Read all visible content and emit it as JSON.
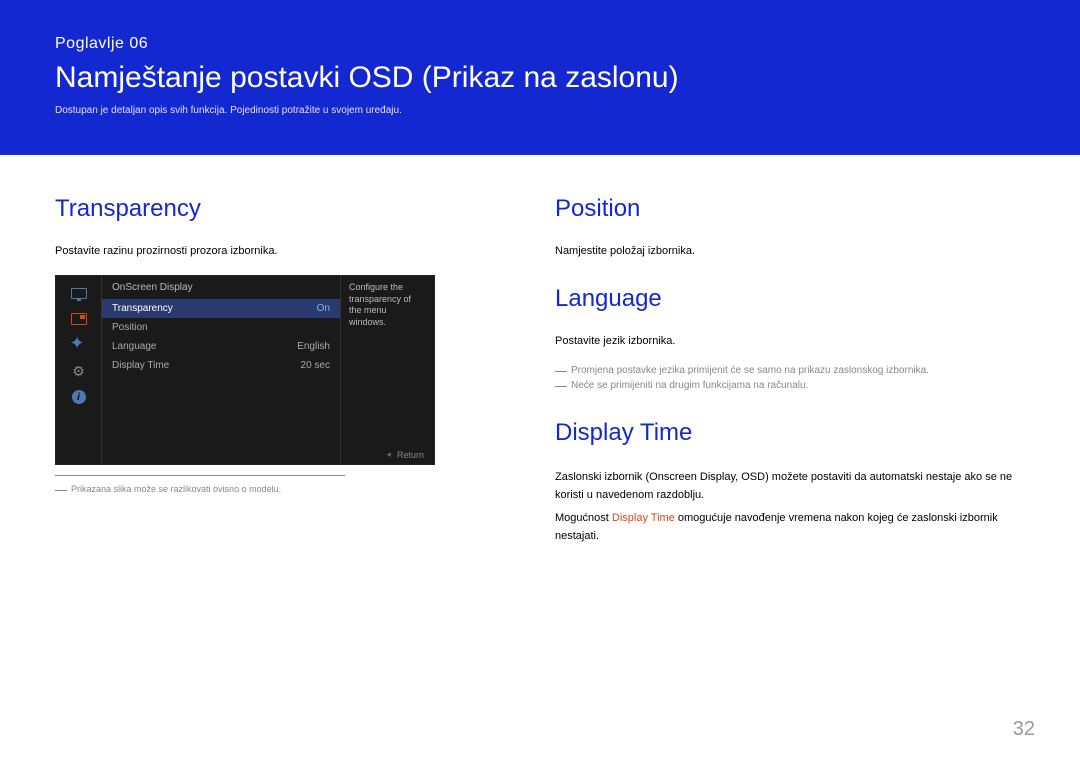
{
  "header": {
    "chapter": "Poglavlje 06",
    "title": "Namještanje postavki OSD (Prikaz na zaslonu)",
    "subtitle": "Dostupan je detaljan opis svih funkcija. Pojedinosti potražite u svojem uređaju."
  },
  "left": {
    "transparency": {
      "title": "Transparency",
      "desc": "Postavite razinu prozirnosti prozora izbornika."
    },
    "osd": {
      "menu_title": "OnScreen Display",
      "items": [
        {
          "label": "Transparency",
          "value": "On",
          "selected": true
        },
        {
          "label": "Position",
          "value": "",
          "selected": false
        },
        {
          "label": "Language",
          "value": "English",
          "selected": false
        },
        {
          "label": "Display Time",
          "value": "20 sec",
          "selected": false
        }
      ],
      "desc": "Configure the transparency of the menu windows.",
      "return": "Return"
    },
    "footnote": "Prikazana slika može se razlikovati ovisno o modelu."
  },
  "right": {
    "position": {
      "title": "Position",
      "desc": "Namjestite položaj izbornika."
    },
    "language": {
      "title": "Language",
      "desc": "Postavite jezik izbornika.",
      "note1": "Promjena postavke jezika primijenit će se samo na prikazu zaslonskog izbornika.",
      "note2": "Neće se primijeniti na drugim funkcijama na računalu."
    },
    "display_time": {
      "title": "Display Time",
      "p1": "Zaslonski izbornik (Onscreen Display, OSD) možete postaviti da automatski nestaje ako se ne koristi u navedenom razdoblju.",
      "p2a": "Mogućnost ",
      "p2b": "Display Time",
      "p2c": " omogućuje navođenje vremena nakon kojeg će zaslonski izbornik nestajati."
    }
  },
  "page": "32"
}
